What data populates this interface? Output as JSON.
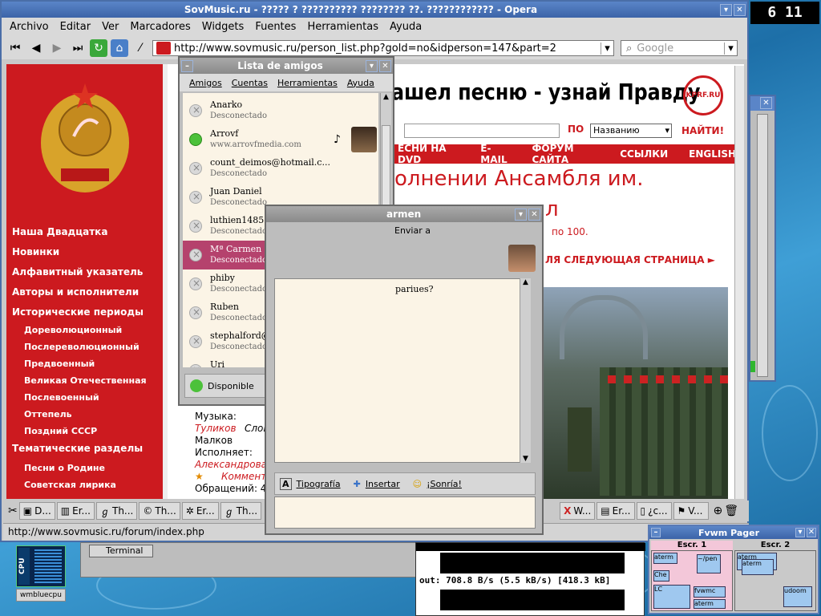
{
  "opera": {
    "title": "SovMusic.ru - ????? ? ?????????? ???????? ??. ???????????? - Opera",
    "menu": [
      "Archivo",
      "Editar",
      "Ver",
      "Marcadores",
      "Widgets",
      "Fuentes",
      "Herramientas",
      "Ayuda"
    ],
    "address": "http://www.sovmusic.ru/person_list.php?gold=no&idperson=147&part=2",
    "search_placeholder": "Google",
    "status_url": "http://www.sovmusic.ru/forum/index.php"
  },
  "page": {
    "banner_text": "ашел песню - узнай Правду",
    "banner_logo": "KPRF.RU",
    "search_by_label": "ПО",
    "search_select_value": "Названию",
    "search_button": "НАЙТИ!",
    "nav_items": [
      "ЕСНИ НА DVD",
      "E-MAIL",
      "ФОРУМ САЙТА",
      "ССЫЛКИ",
      "ENGLISH"
    ],
    "heading_line1": "олнении Ансамбля им.",
    "heading_line2": "л",
    "range_text": "по 100.",
    "next_page": "ЛЯ СЛЕДУЮЩАЯ СТРАНИЦА ►",
    "sidebar": [
      {
        "label": "Наша Двадцатка",
        "sub": false
      },
      {
        "label": "Новинки",
        "sub": false
      },
      {
        "label": "Алфавитный указатель",
        "sub": false
      },
      {
        "label": "Авторы и исполнители",
        "sub": false
      },
      {
        "label": "Исторические периоды",
        "sub": false
      },
      {
        "label": "Дореволюционный",
        "sub": true
      },
      {
        "label": "Послереволюционный",
        "sub": true
      },
      {
        "label": "Предвоенный",
        "sub": true
      },
      {
        "label": "Великая Отечественная",
        "sub": true
      },
      {
        "label": "Послевоенный",
        "sub": true
      },
      {
        "label": "Оттепель",
        "sub": true
      },
      {
        "label": "Поздний СССР",
        "sub": true
      },
      {
        "label": "Тематические разделы",
        "sub": false
      },
      {
        "label": "Песни о Родине",
        "sub": true
      },
      {
        "label": "Советская лирика",
        "sub": true
      }
    ],
    "song_music_label": "Музыка:",
    "song_composer": "Туликов",
    "song_words_label": "Слов",
    "song_lyricist": "Малков",
    "song_performer_label": "Исполняет:",
    "song_performer": "Александрова",
    "song_comments": "Коммента",
    "song_requests": "Обращений: 45"
  },
  "taskbar": [
    "D...",
    "Er...",
    "Th...",
    "Th...",
    "Er...",
    "Th...",
    "W...",
    "Er...",
    "¿c...",
    "V..."
  ],
  "friends": {
    "title": "Lista de amigos",
    "menu": [
      "Amigos",
      "Cuentas",
      "Herramientas",
      "Ayuda"
    ],
    "contacts": [
      {
        "name": "Anarko",
        "status": "Desconectado",
        "online": false
      },
      {
        "name": "Arrovf",
        "status": "www.arrovfmedia.com",
        "online": true
      },
      {
        "name": "count_deimos@hotmail.c...",
        "status": "Desconectado",
        "online": false
      },
      {
        "name": "Juan Daniel",
        "status": "Desconectado",
        "online": false
      },
      {
        "name": "luthien1485@hotmail.com",
        "status": "Desconectado",
        "online": false
      },
      {
        "name": "Mª Carmen",
        "status": "Desconectado",
        "online": false
      },
      {
        "name": "phiby",
        "status": "Desconectado",
        "online": false
      },
      {
        "name": "Ruben",
        "status": "Desconectado",
        "online": false
      },
      {
        "name": "stephalford@hotmail.com",
        "status": "Desconectado",
        "online": false
      },
      {
        "name": "Uri",
        "status": "",
        "online": false
      }
    ],
    "selected_index": 5,
    "presence": "Disponible"
  },
  "chat": {
    "title": "armen",
    "send_to": "Enviar a",
    "message": "pariues?",
    "toolbar": [
      "Tipografía",
      "Insertar",
      "¡Sonría!"
    ]
  },
  "desktop": {
    "clock": "6 11",
    "cpu_label": "CPU",
    "wmblue_label": "wmbluecpu",
    "terminal_label": "Terminal",
    "net_line1": "out:  708.8 B/s (5.5 kB/s) [418.3 kB]",
    "pager_title": "Fvwm Pager",
    "desks": [
      "Escr. 1",
      "Escr. 2"
    ],
    "pager_windows": [
      "aterm",
      "~/pen",
      "Che",
      "aterm",
      "aterm",
      "LC",
      "fvwmc",
      "aterm",
      "udoom"
    ]
  },
  "colors": {
    "accent_red": "#cc1a1f",
    "title_blue": "#4a6ea8",
    "selected_row": "#b5426d"
  }
}
